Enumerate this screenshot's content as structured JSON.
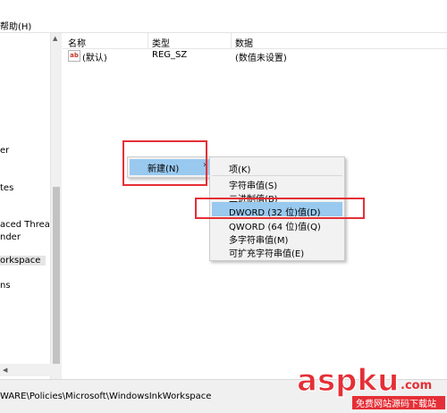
{
  "menubar": {
    "help_label": "帮助(H)"
  },
  "tree": {
    "items": [
      "er",
      "tes",
      "aced Threat P",
      "nder",
      "orkspace",
      "ns"
    ]
  },
  "list": {
    "columns": [
      "名称",
      "类型",
      "数据"
    ],
    "rows": [
      {
        "name": "(默认)",
        "type": "REG_SZ",
        "data": "(数值未设置)"
      }
    ]
  },
  "context_menu": {
    "new_label": "新建(N)",
    "chevron": "›"
  },
  "submenu": {
    "items": [
      "项(K)",
      "字符串值(S)",
      "二进制值(B)",
      "DWORD (32 位)值(D)",
      "QWORD (64 位)值(Q)",
      "多字符串值(M)",
      "可扩充字符串值(E)"
    ]
  },
  "status": {
    "path": "WARE\\Policies\\Microsoft\\WindowsInkWorkspace"
  },
  "watermark": {
    "brand": "aspku",
    "suffix": ".com",
    "tagline": "免费网站源码下载站"
  },
  "colors": {
    "highlight": "#99c9ef",
    "annotation_red": "#e52f36",
    "watermark_red": "#e52f36"
  }
}
